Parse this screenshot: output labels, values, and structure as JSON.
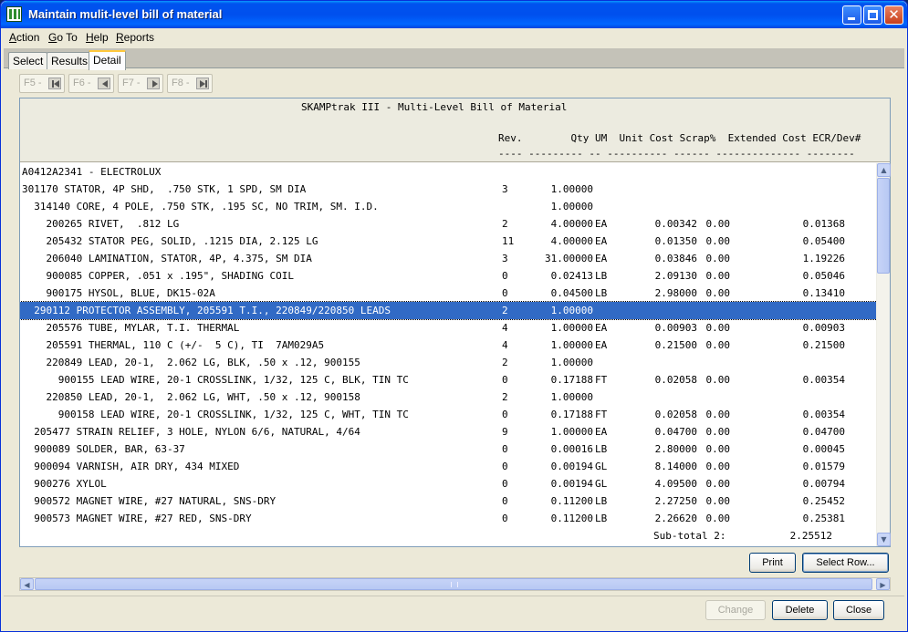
{
  "window": {
    "title": "Maintain mulit-level bill of material"
  },
  "menu": [
    "Action",
    "Go To",
    "Help",
    "Reports"
  ],
  "tabs": [
    "Select",
    "Results",
    "Detail"
  ],
  "nav": [
    {
      "label": "F5 -",
      "icon": "first-record-icon"
    },
    {
      "label": "F6 -",
      "icon": "previous-record-icon"
    },
    {
      "label": "F7 -",
      "icon": "next-record-icon"
    },
    {
      "label": "F8 -",
      "icon": "last-record-icon"
    }
  ],
  "report": {
    "title": "SKAMPtrak III - Multi-Level Bill of Material",
    "header_line1": "Rev.        Qty UM  Unit Cost Scrap%  Extended Cost ECR/Dev#",
    "header_line2": "---- --------- -- ---------- ------ -------------- --------",
    "rows": [
      {
        "desc": "A0412A2341 - ELECTROLUX",
        "rev": "",
        "qty": "",
        "um": "",
        "unit": "",
        "scrap": "",
        "ext": ""
      },
      {
        "desc": "301170 STATOR, 4P SHD,  .750 STK, 1 SPD, SM DIA",
        "rev": "3",
        "qty": "1.00000",
        "um": "",
        "unit": "",
        "scrap": "",
        "ext": ""
      },
      {
        "desc": "  314140 CORE, 4 POLE, .750 STK, .195 SC, NO TRIM, SM. I.D.",
        "rev": "",
        "qty": "1.00000",
        "um": "",
        "unit": "",
        "scrap": "",
        "ext": ""
      },
      {
        "desc": "    200265 RIVET,  .812 LG",
        "rev": "2",
        "qty": "4.00000",
        "um": "EA",
        "unit": "0.00342",
        "scrap": "0.00",
        "ext": "0.01368"
      },
      {
        "desc": "    205432 STATOR PEG, SOLID, .1215 DIA, 2.125 LG",
        "rev": "11",
        "qty": "4.00000",
        "um": "EA",
        "unit": "0.01350",
        "scrap": "0.00",
        "ext": "0.05400"
      },
      {
        "desc": "    206040 LAMINATION, STATOR, 4P, 4.375, SM DIA",
        "rev": "3",
        "qty": "31.00000",
        "um": "EA",
        "unit": "0.03846",
        "scrap": "0.00",
        "ext": "1.19226"
      },
      {
        "desc": "    900085 COPPER, .051 x .195\", SHADING COIL",
        "rev": "0",
        "qty": "0.02413",
        "um": "LB",
        "unit": "2.09130",
        "scrap": "0.00",
        "ext": "0.05046"
      },
      {
        "desc": "    900175 HYSOL, BLUE, DK15-02A",
        "rev": "0",
        "qty": "0.04500",
        "um": "LB",
        "unit": "2.98000",
        "scrap": "0.00",
        "ext": "0.13410"
      },
      {
        "desc": "  290112 PROTECTOR ASSEMBLY, 205591 T.I., 220849/220850 LEADS",
        "rev": "2",
        "qty": "1.00000",
        "um": "",
        "unit": "",
        "scrap": "",
        "ext": "",
        "selected": true
      },
      {
        "desc": "    205576 TUBE, MYLAR, T.I. THERMAL",
        "rev": "4",
        "qty": "1.00000",
        "um": "EA",
        "unit": "0.00903",
        "scrap": "0.00",
        "ext": "0.00903"
      },
      {
        "desc": "    205591 THERMAL, 110 C (+/-  5 C), TI  7AM029A5",
        "rev": "4",
        "qty": "1.00000",
        "um": "EA",
        "unit": "0.21500",
        "scrap": "0.00",
        "ext": "0.21500"
      },
      {
        "desc": "    220849 LEAD, 20-1,  2.062 LG, BLK, .50 x .12, 900155",
        "rev": "2",
        "qty": "1.00000",
        "um": "",
        "unit": "",
        "scrap": "",
        "ext": ""
      },
      {
        "desc": "      900155 LEAD WIRE, 20-1 CROSSLINK, 1/32, 125 C, BLK, TIN TC",
        "rev": "0",
        "qty": "0.17188",
        "um": "FT",
        "unit": "0.02058",
        "scrap": "0.00",
        "ext": "0.00354"
      },
      {
        "desc": "    220850 LEAD, 20-1,  2.062 LG, WHT, .50 x .12, 900158",
        "rev": "2",
        "qty": "1.00000",
        "um": "",
        "unit": "",
        "scrap": "",
        "ext": ""
      },
      {
        "desc": "      900158 LEAD WIRE, 20-1 CROSSLINK, 1/32, 125 C, WHT, TIN TC",
        "rev": "0",
        "qty": "0.17188",
        "um": "FT",
        "unit": "0.02058",
        "scrap": "0.00",
        "ext": "0.00354"
      },
      {
        "desc": "  205477 STRAIN RELIEF, 3 HOLE, NYLON 6/6, NATURAL, 4/64",
        "rev": "9",
        "qty": "1.00000",
        "um": "EA",
        "unit": "0.04700",
        "scrap": "0.00",
        "ext": "0.04700"
      },
      {
        "desc": "  900089 SOLDER, BAR, 63-37",
        "rev": "0",
        "qty": "0.00016",
        "um": "LB",
        "unit": "2.80000",
        "scrap": "0.00",
        "ext": "0.00045"
      },
      {
        "desc": "  900094 VARNISH, AIR DRY, 434 MIXED",
        "rev": "0",
        "qty": "0.00194",
        "um": "GL",
        "unit": "8.14000",
        "scrap": "0.00",
        "ext": "0.01579"
      },
      {
        "desc": "  900276 XYLOL",
        "rev": "0",
        "qty": "0.00194",
        "um": "GL",
        "unit": "4.09500",
        "scrap": "0.00",
        "ext": "0.00794"
      },
      {
        "desc": "  900572 MAGNET WIRE, #27 NATURAL, SNS-DRY",
        "rev": "0",
        "qty": "0.11200",
        "um": "LB",
        "unit": "2.27250",
        "scrap": "0.00",
        "ext": "0.25452"
      },
      {
        "desc": "  900573 MAGNET WIRE, #27 RED, SNS-DRY",
        "rev": "0",
        "qty": "0.11200",
        "um": "LB",
        "unit": "2.26620",
        "scrap": "0.00",
        "ext": "0.25381"
      }
    ],
    "subtotal_label": "Sub-total 2:",
    "subtotal_value": "2.25512"
  },
  "buttons": {
    "print": "Print",
    "select_row": "Select Row...",
    "change": "Change",
    "delete": "Delete",
    "close": "Close"
  },
  "colors": {
    "selection": "#316ac5",
    "titlebar": "#0053ee",
    "active_tab_accent": "#ffc83c"
  }
}
